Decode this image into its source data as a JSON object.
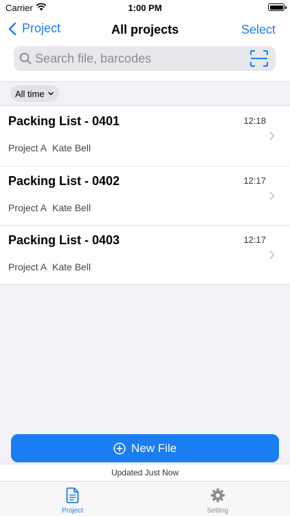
{
  "status_bar": {
    "carrier": "Carrier",
    "time": "1:00 PM"
  },
  "nav": {
    "back_label": "Project",
    "title": "All projects",
    "select_label": "Select"
  },
  "search": {
    "placeholder": "Search file, barcodes",
    "value": ""
  },
  "filter": {
    "label": "All time"
  },
  "files": [
    {
      "title": "Packing List - 0401",
      "time": "12:18",
      "project": "Project A",
      "user": "Kate Bell"
    },
    {
      "title": "Packing List - 0402",
      "time": "12:17",
      "project": "Project A",
      "user": "Kate Bell"
    },
    {
      "title": "Packing List - 0403",
      "time": "12:17",
      "project": "Project A",
      "user": "Kate Bell"
    }
  ],
  "new_file_label": "New File",
  "update_status": "Updated Just Now",
  "tabs": [
    {
      "label": "Project",
      "icon": "document-icon",
      "active": true
    },
    {
      "label": "Setting",
      "icon": "gear-icon",
      "active": false
    }
  ],
  "colors": {
    "accent": "#1a7df2",
    "inactive": "#8e8e93"
  }
}
